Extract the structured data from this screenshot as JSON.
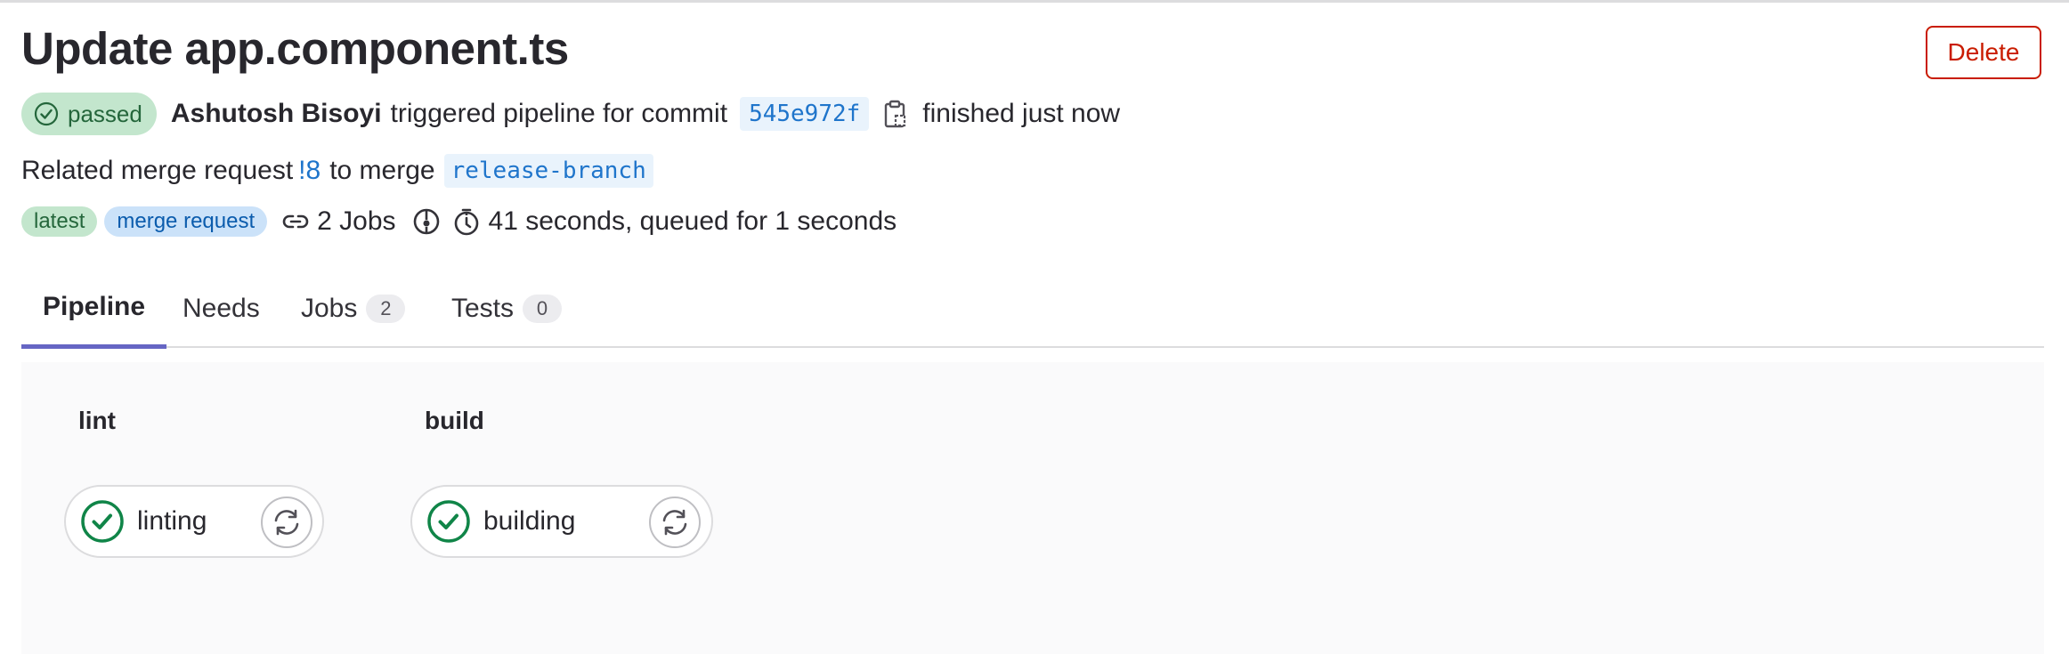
{
  "header": {
    "title": "Update app.component.ts",
    "delete_label": "Delete"
  },
  "pipeline_info": {
    "status": "passed",
    "author": "Ashutosh Bisoyi",
    "triggered_text": "triggered pipeline for commit",
    "commit_sha": "545e972f",
    "finished_text": "finished just now"
  },
  "merge_info": {
    "prefix": "Related merge request",
    "mr_ref": "!8",
    "to_merge": "to merge",
    "branch": "release-branch"
  },
  "meta": {
    "badges": [
      "latest",
      "merge request"
    ],
    "jobs_text": "2 Jobs",
    "duration_text": "41 seconds, queued for 1 seconds"
  },
  "tabs": [
    {
      "label": "Pipeline",
      "active": true
    },
    {
      "label": "Needs"
    },
    {
      "label": "Jobs",
      "count": "2"
    },
    {
      "label": "Tests",
      "count": "0"
    }
  ],
  "stages": [
    {
      "name": "lint",
      "jobs": [
        {
          "name": "linting",
          "status": "success"
        }
      ]
    },
    {
      "name": "build",
      "jobs": [
        {
          "name": "building",
          "status": "success"
        }
      ]
    }
  ],
  "colors": {
    "success": "#108548",
    "danger": "#c91c00",
    "link": "#1f75cb",
    "active_tab": "#6666c4"
  },
  "icons": {
    "status": "check-circle-icon",
    "copy": "copy-to-clipboard-icon",
    "jobs": "link-icon",
    "pipeline": "pipeline-icon",
    "duration": "stopwatch-icon",
    "retry": "retry-icon"
  }
}
